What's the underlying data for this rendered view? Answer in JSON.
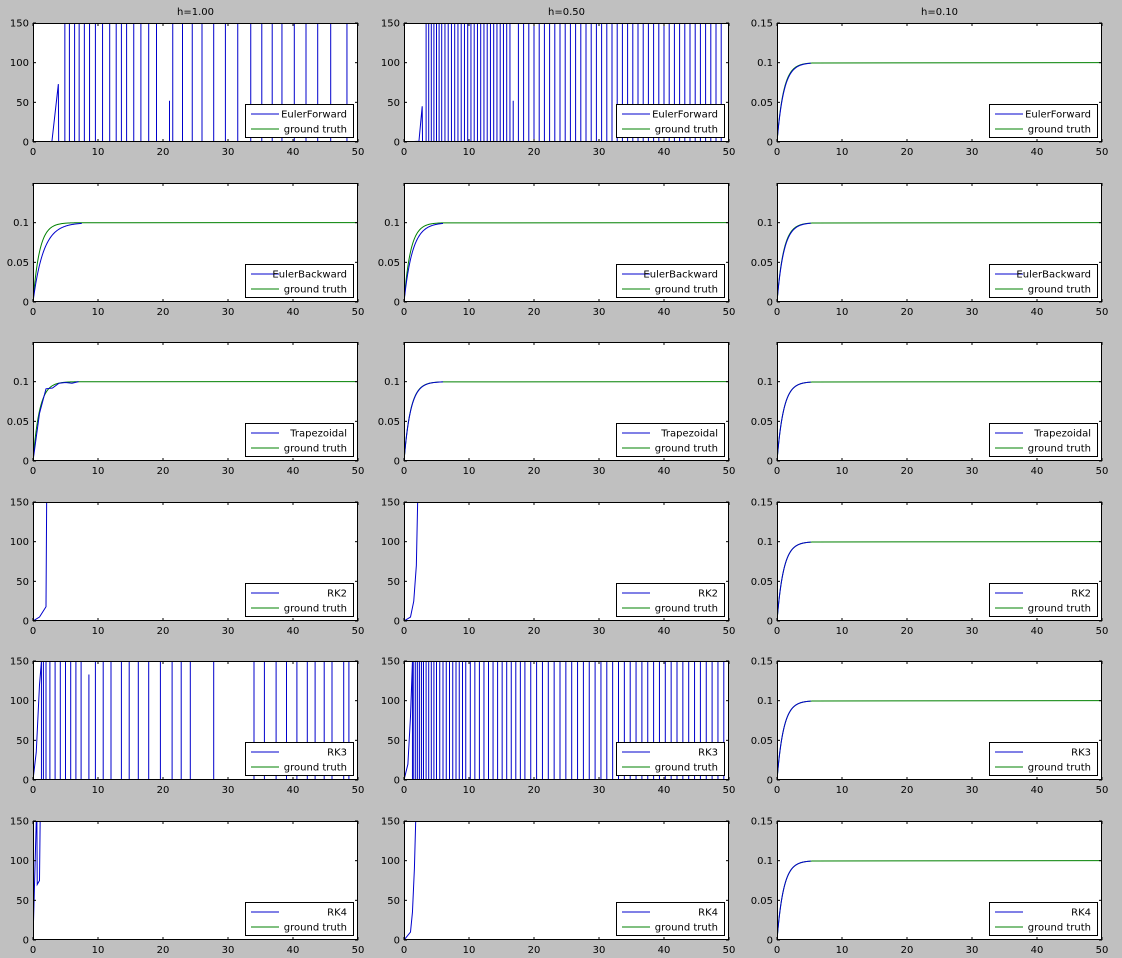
{
  "colors": {
    "background": "#c0c0c0",
    "axes": "#ffffff",
    "method": "#0000cc",
    "truth": "#008000",
    "legend_border": "#000000"
  },
  "chart_data": [
    {
      "type": "line",
      "row": 0,
      "col": 0,
      "title": "h=1.00",
      "method": "EulerForward",
      "truth": "ground truth",
      "ylim": [
        0,
        150
      ],
      "yticks": [
        "0",
        "50",
        "100",
        "150"
      ],
      "xlim": [
        0,
        50
      ],
      "xticks": [
        "0",
        "10",
        "20",
        "30",
        "40",
        "50"
      ],
      "legend": "bottom-right",
      "grid": false,
      "behavior": "oscillating",
      "ramp": [
        [
          0,
          0
        ],
        [
          2.9,
          0
        ],
        [
          3.9,
          73
        ],
        [
          3.95,
          0
        ]
      ],
      "spikes": [
        4.9,
        5.6,
        6.4,
        7.1,
        7.9,
        8.7,
        9.6,
        10.7,
        11.8,
        12.8,
        13.6,
        14.4,
        15.5,
        16.6,
        17.8,
        19.0,
        21.5,
        23.0,
        24.5,
        26.0,
        27.8,
        29.6,
        31.5,
        33.5,
        35.2,
        36.8,
        38.3,
        40.2,
        42.0,
        43.8,
        45.8,
        48.3
      ],
      "partial_spikes": [
        [
          21.0,
          52
        ]
      ]
    },
    {
      "type": "line",
      "row": 0,
      "col": 1,
      "title": "h=0.50",
      "method": "EulerForward",
      "truth": "ground truth",
      "ylim": [
        0,
        150
      ],
      "yticks": [
        "0",
        "50",
        "100",
        "150"
      ],
      "xlim": [
        0,
        50
      ],
      "xticks": [
        "0",
        "10",
        "20",
        "30",
        "40",
        "50"
      ],
      "legend": "bottom-right",
      "grid": false,
      "behavior": "oscillating",
      "ramp": [
        [
          0,
          0
        ],
        [
          2.3,
          1
        ],
        [
          2.8,
          45
        ],
        [
          2.85,
          0
        ]
      ],
      "spikes": [
        3.4,
        3.8,
        4.2,
        4.6,
        5.0,
        5.4,
        5.8,
        6.3,
        6.8,
        7.3,
        7.8,
        8.3,
        8.8,
        9.3,
        9.8,
        10.3,
        10.8,
        11.3,
        11.8,
        12.3,
        12.8,
        13.3,
        13.8,
        14.3,
        14.8,
        15.3,
        15.8,
        16.3,
        17.6,
        18.4,
        19.2,
        20.0,
        20.8,
        21.6,
        22.4,
        23.2,
        24.0,
        24.8,
        25.6,
        26.4,
        27.2,
        28.0,
        28.8,
        29.6,
        30.4,
        31.2,
        32.0,
        32.8,
        33.6,
        34.4,
        35.2,
        36.0,
        36.8,
        37.6,
        38.4,
        39.2,
        40.0,
        40.8,
        41.6,
        42.4,
        43.2,
        44.0,
        44.8,
        45.6,
        46.4,
        47.2,
        48.0,
        48.8
      ],
      "partial_spikes": [
        [
          16.8,
          52
        ]
      ]
    },
    {
      "type": "line",
      "row": 0,
      "col": 2,
      "title": "h=0.10",
      "method": "EulerForward",
      "truth": "ground truth",
      "ylim": [
        0,
        0.15
      ],
      "yticks": [
        "0",
        "0.05",
        "0.1",
        "0.15"
      ],
      "xlim": [
        0,
        50
      ],
      "xticks": [
        "0",
        "10",
        "20",
        "30",
        "40",
        "50"
      ],
      "legend": "bottom-right",
      "grid": false,
      "behavior": "converge",
      "x_end": 5.5,
      "method_tau": 1.05,
      "method_x_end": 5.2,
      "truth_tau": 1.0
    },
    {
      "type": "line",
      "row": 1,
      "col": 0,
      "title": "",
      "method": "EulerBackward",
      "truth": "ground truth",
      "ylim": [
        0,
        0.15
      ],
      "yticks": [
        "0",
        "0.05",
        "0.1"
      ],
      "xlim": [
        0,
        50
      ],
      "xticks": [
        "0",
        "10",
        "20",
        "30",
        "40",
        "50"
      ],
      "legend": "bottom-right",
      "grid": false,
      "behavior": "converge",
      "x_end": 7.5,
      "method_tau": 1.6,
      "method_x_end": 7.5,
      "truth_tau": 1.0
    },
    {
      "type": "line",
      "row": 1,
      "col": 1,
      "title": "",
      "method": "EulerBackward",
      "truth": "ground truth",
      "ylim": [
        0,
        0.15
      ],
      "yticks": [
        "0",
        "0.05",
        "0.1"
      ],
      "xlim": [
        0,
        50
      ],
      "xticks": [
        "0",
        "10",
        "20",
        "30",
        "40",
        "50"
      ],
      "legend": "bottom-right",
      "grid": false,
      "behavior": "converge",
      "x_end": 6.0,
      "method_tau": 1.3,
      "method_x_end": 6.0,
      "truth_tau": 1.0
    },
    {
      "type": "line",
      "row": 1,
      "col": 2,
      "title": "",
      "method": "EulerBackward",
      "truth": "ground truth",
      "ylim": [
        0,
        0.15
      ],
      "yticks": [
        "0",
        "0.05",
        "0.1"
      ],
      "xlim": [
        0,
        50
      ],
      "xticks": [
        "0",
        "10",
        "20",
        "30",
        "40",
        "50"
      ],
      "legend": "bottom-right",
      "grid": false,
      "behavior": "converge",
      "x_end": 5.5,
      "method_tau": 1.05,
      "method_x_end": 5.2,
      "truth_tau": 1.0
    },
    {
      "type": "line",
      "row": 2,
      "col": 0,
      "title": "",
      "method": "Trapezoidal",
      "truth": "ground truth",
      "ylim": [
        0,
        0.15
      ],
      "yticks": [
        "0",
        "0.05",
        "0.1"
      ],
      "xlim": [
        0,
        50
      ],
      "xticks": [
        "0",
        "10",
        "20",
        "30",
        "40",
        "50"
      ],
      "legend": "bottom-right",
      "grid": false,
      "behavior": "converge",
      "x_end": 7.5,
      "method_points": [
        [
          0,
          0
        ],
        [
          1,
          0.06
        ],
        [
          2,
          0.091
        ],
        [
          3,
          0.092
        ],
        [
          4,
          0.098
        ],
        [
          5,
          0.099
        ],
        [
          6,
          0.098
        ],
        [
          7,
          0.1
        ]
      ],
      "truth_tau": 1.0
    },
    {
      "type": "line",
      "row": 2,
      "col": 1,
      "title": "",
      "method": "Trapezoidal",
      "truth": "ground truth",
      "ylim": [
        0,
        0.15
      ],
      "yticks": [
        "0",
        "0.05",
        "0.1"
      ],
      "xlim": [
        0,
        50
      ],
      "xticks": [
        "0",
        "10",
        "20",
        "30",
        "40",
        "50"
      ],
      "legend": "bottom-right",
      "grid": false,
      "behavior": "converge",
      "x_end": 6.0,
      "method_tau": 1.02,
      "method_x_end": 6.0,
      "truth_tau": 1.0
    },
    {
      "type": "line",
      "row": 2,
      "col": 2,
      "title": "",
      "method": "Trapezoidal",
      "truth": "ground truth",
      "ylim": [
        0,
        0.15
      ],
      "yticks": [
        "0",
        "0.05",
        "0.1"
      ],
      "xlim": [
        0,
        50
      ],
      "xticks": [
        "0",
        "10",
        "20",
        "30",
        "40",
        "50"
      ],
      "legend": "bottom-right",
      "grid": false,
      "behavior": "converge",
      "x_end": 5.5,
      "method_tau": 1.0,
      "method_x_end": 5.2,
      "truth_tau": 1.0
    },
    {
      "type": "line",
      "row": 3,
      "col": 0,
      "title": "",
      "method": "RK2",
      "truth": "ground truth",
      "ylim": [
        0,
        150
      ],
      "yticks": [
        "0",
        "50",
        "100",
        "150"
      ],
      "xlim": [
        0,
        50
      ],
      "xticks": [
        "0",
        "10",
        "20",
        "30",
        "40",
        "50"
      ],
      "legend": "bottom-right",
      "grid": false,
      "behavior": "blowup",
      "method_points": [
        [
          0,
          0
        ],
        [
          1.0,
          5
        ],
        [
          2.0,
          18
        ],
        [
          2.1,
          150
        ]
      ]
    },
    {
      "type": "line",
      "row": 3,
      "col": 1,
      "title": "",
      "method": "RK2",
      "truth": "ground truth",
      "ylim": [
        0,
        150
      ],
      "yticks": [
        "0",
        "50",
        "100",
        "150"
      ],
      "xlim": [
        0,
        50
      ],
      "xticks": [
        "0",
        "10",
        "20",
        "30",
        "40",
        "50"
      ],
      "legend": "bottom-right",
      "grid": false,
      "behavior": "blowup",
      "method_points": [
        [
          0,
          0
        ],
        [
          1.0,
          5
        ],
        [
          1.5,
          25
        ],
        [
          1.9,
          70
        ],
        [
          2.1,
          150
        ]
      ]
    },
    {
      "type": "line",
      "row": 3,
      "col": 2,
      "title": "",
      "method": "RK2",
      "truth": "ground truth",
      "ylim": [
        0,
        0.15
      ],
      "yticks": [
        "0",
        "0.05",
        "0.1",
        "0.15"
      ],
      "xlim": [
        0,
        50
      ],
      "xticks": [
        "0",
        "10",
        "20",
        "30",
        "40",
        "50"
      ],
      "legend": "bottom-right",
      "grid": false,
      "behavior": "converge",
      "x_end": 5.5,
      "method_tau": 1.0,
      "method_x_end": 5.2,
      "truth_tau": 1.0
    },
    {
      "type": "line",
      "row": 4,
      "col": 0,
      "title": "",
      "method": "RK3",
      "truth": "ground truth",
      "ylim": [
        0,
        150
      ],
      "yticks": [
        "0",
        "50",
        "100",
        "150"
      ],
      "xlim": [
        0,
        50
      ],
      "xticks": [
        "0",
        "10",
        "20",
        "30",
        "40",
        "50"
      ],
      "legend": "bottom-right",
      "grid": false,
      "behavior": "oscillating",
      "ramp": [
        [
          0,
          0
        ],
        [
          0.5,
          35
        ],
        [
          1.0,
          120
        ],
        [
          1.3,
          150
        ]
      ],
      "spikes": [
        1.6,
        2.0,
        2.6,
        3.4,
        4.2,
        5.0,
        5.8,
        6.6,
        7.4,
        9.6,
        10.8,
        12.0,
        13.6,
        14.8,
        16.2,
        17.8,
        19.6,
        21.4,
        22.8,
        24.2,
        27.8,
        34.0,
        35.6,
        37.4,
        39.0,
        40.6,
        42.2,
        43.4,
        44.8,
        46.0,
        47.8,
        48.6
      ],
      "partial_spikes": [
        [
          8.6,
          133
        ]
      ]
    },
    {
      "type": "line",
      "row": 4,
      "col": 1,
      "title": "",
      "method": "RK3",
      "truth": "ground truth",
      "ylim": [
        0,
        150
      ],
      "yticks": [
        "0",
        "50",
        "100",
        "150"
      ],
      "xlim": [
        0,
        50
      ],
      "xticks": [
        "0",
        "10",
        "20",
        "30",
        "40",
        "50"
      ],
      "legend": "bottom-right",
      "grid": false,
      "behavior": "oscillating",
      "ramp": [
        [
          0,
          0
        ],
        [
          0.6,
          20
        ],
        [
          1.0,
          80
        ],
        [
          1.3,
          150
        ]
      ],
      "spikes": [
        1.5,
        1.8,
        2.1,
        2.4,
        2.7,
        3.0,
        3.4,
        3.8,
        4.2,
        4.6,
        5.0,
        5.5,
        6.0,
        6.5,
        7.0,
        7.5,
        8.0,
        8.5,
        9.0,
        9.5,
        10.2,
        10.9,
        11.6,
        12.3,
        13.0,
        13.7,
        14.4,
        15.1,
        15.8,
        16.5,
        17.2,
        17.9,
        18.6,
        19.5,
        20.4,
        21.3,
        22.2,
        23.1,
        24.0,
        24.9,
        25.8,
        26.7,
        27.6,
        28.5,
        29.4,
        30.3,
        31.2,
        32.1,
        33.0,
        33.9,
        34.8,
        35.7,
        36.6,
        37.5,
        38.4,
        39.3,
        40.2,
        41.1,
        42.0,
        42.9,
        43.8,
        44.7,
        45.6,
        46.5,
        47.4,
        48.3,
        49.2
      ],
      "partial_spikes": []
    },
    {
      "type": "line",
      "row": 4,
      "col": 2,
      "title": "",
      "method": "RK3",
      "truth": "ground truth",
      "ylim": [
        0,
        0.15
      ],
      "yticks": [
        "0",
        "0.05",
        "0.1",
        "0.15"
      ],
      "xlim": [
        0,
        50
      ],
      "xticks": [
        "0",
        "10",
        "20",
        "30",
        "40",
        "50"
      ],
      "legend": "bottom-right",
      "grid": false,
      "behavior": "converge",
      "x_end": 5.5,
      "method_tau": 1.0,
      "method_x_end": 5.2,
      "truth_tau": 1.0
    },
    {
      "type": "line",
      "row": 5,
      "col": 0,
      "title": "",
      "method": "RK4",
      "truth": "ground truth",
      "ylim": [
        0,
        150
      ],
      "yticks": [
        "0",
        "50",
        "100",
        "150"
      ],
      "xlim": [
        0,
        50
      ],
      "xticks": [
        "0",
        "10",
        "20",
        "30",
        "40",
        "50"
      ],
      "legend": "bottom-right",
      "grid": false,
      "behavior": "blowup",
      "method_points": [
        [
          0,
          0
        ],
        [
          0.5,
          150
        ],
        [
          0.6,
          150
        ],
        [
          0.65,
          70
        ],
        [
          1.0,
          75
        ],
        [
          1.1,
          150
        ]
      ]
    },
    {
      "type": "line",
      "row": 5,
      "col": 1,
      "title": "",
      "method": "RK4",
      "truth": "ground truth",
      "ylim": [
        0,
        150
      ],
      "yticks": [
        "0",
        "50",
        "100",
        "150"
      ],
      "xlim": [
        0,
        50
      ],
      "xticks": [
        "0",
        "10",
        "20",
        "30",
        "40",
        "50"
      ],
      "legend": "bottom-right",
      "grid": false,
      "behavior": "blowup",
      "method_points": [
        [
          0,
          0
        ],
        [
          1.0,
          10
        ],
        [
          1.3,
          35
        ],
        [
          1.6,
          90
        ],
        [
          1.8,
          150
        ]
      ]
    },
    {
      "type": "line",
      "row": 5,
      "col": 2,
      "title": "",
      "method": "RK4",
      "truth": "ground truth",
      "ylim": [
        0,
        0.15
      ],
      "yticks": [
        "0",
        "0.05",
        "0.1",
        "0.15"
      ],
      "xlim": [
        0,
        50
      ],
      "xticks": [
        "0",
        "10",
        "20",
        "30",
        "40",
        "50"
      ],
      "legend": "bottom-right",
      "grid": false,
      "behavior": "converge",
      "x_end": 5.5,
      "method_tau": 1.0,
      "method_x_end": 5.2,
      "truth_tau": 1.0
    }
  ]
}
